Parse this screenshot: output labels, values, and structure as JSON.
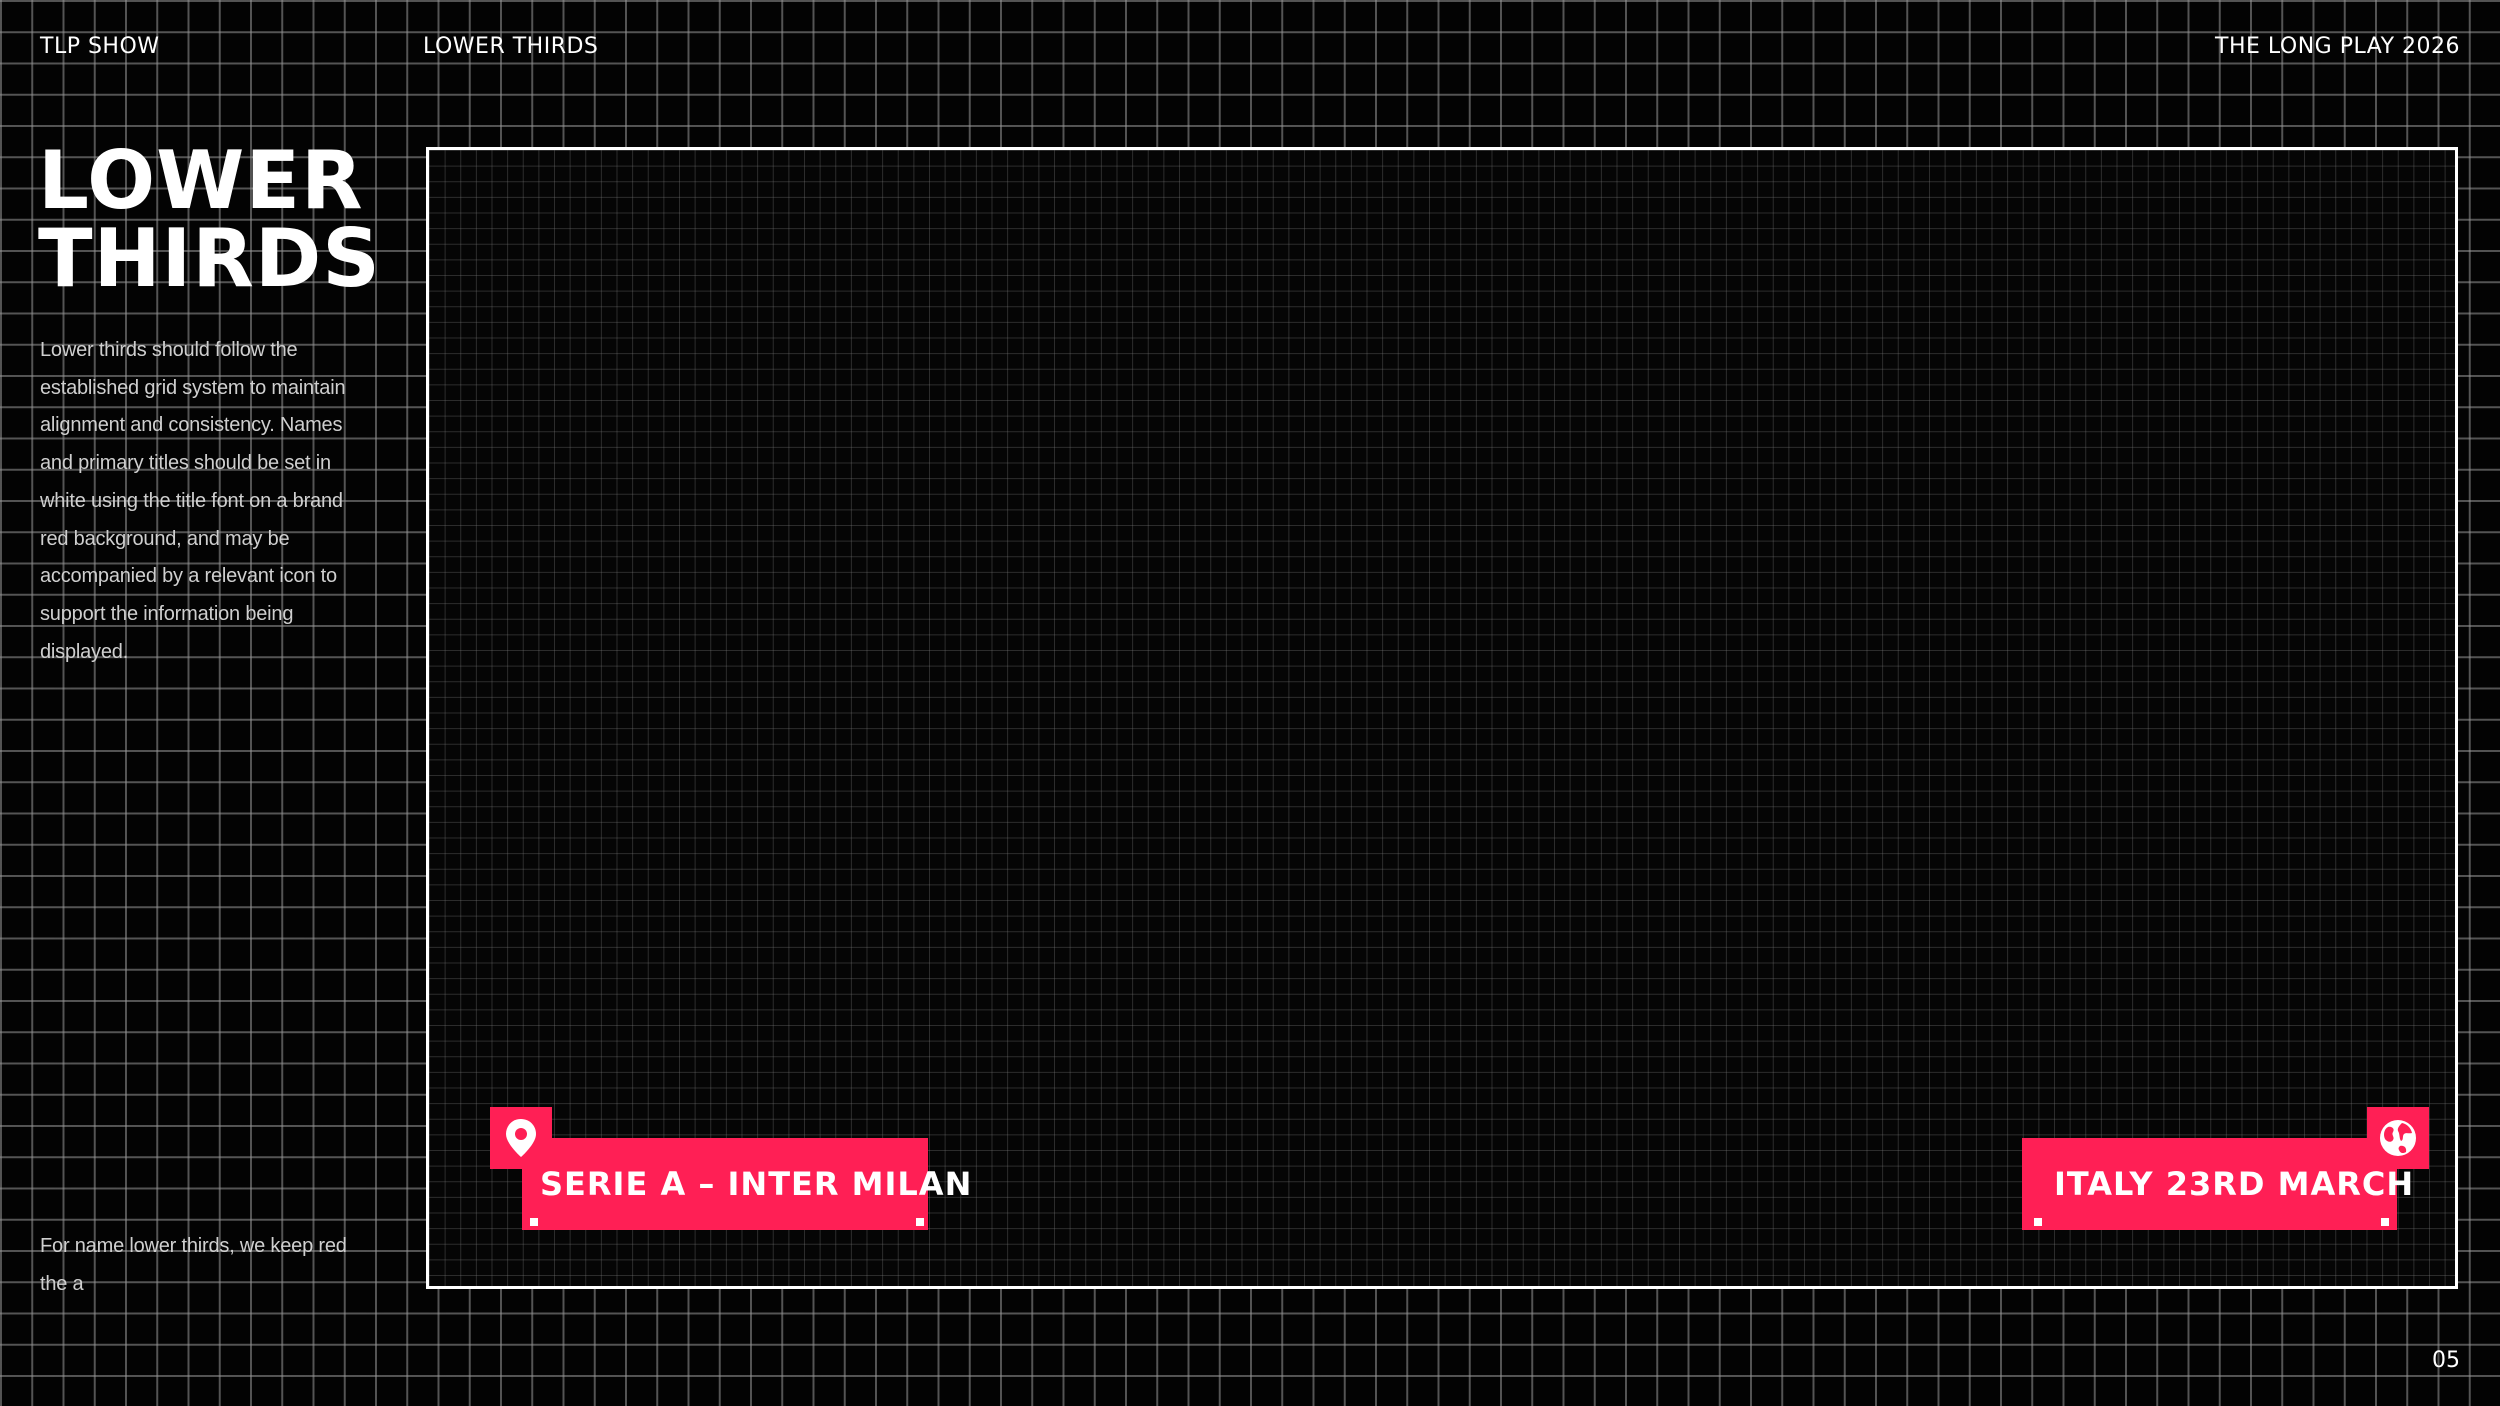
{
  "header": {
    "left": "TLP SHOW",
    "center": "LOWER THIRDS",
    "right": "THE LONG PLAY 2026"
  },
  "title": {
    "line1": "LOWER",
    "line2": "THIRDS"
  },
  "description": "Lower thirds should follow the established grid system to maintain alignment and consistency. Names and primary titles should be set in white using the title font on a brand red background, and may be accompanied by a relevant icon to support the information being displayed.",
  "note": "For name lower thirds, we keep red the a",
  "lower_thirds": [
    {
      "text": "SERIE A – INTER MILAN",
      "icon": "location-pin-icon"
    },
    {
      "text": "ITALY 23RD MARCH",
      "icon": "globe-icon"
    }
  ],
  "page_number": "05",
  "colors": {
    "background": "#030303",
    "brand_red": "#ff1f55",
    "text": "#ffffff"
  }
}
